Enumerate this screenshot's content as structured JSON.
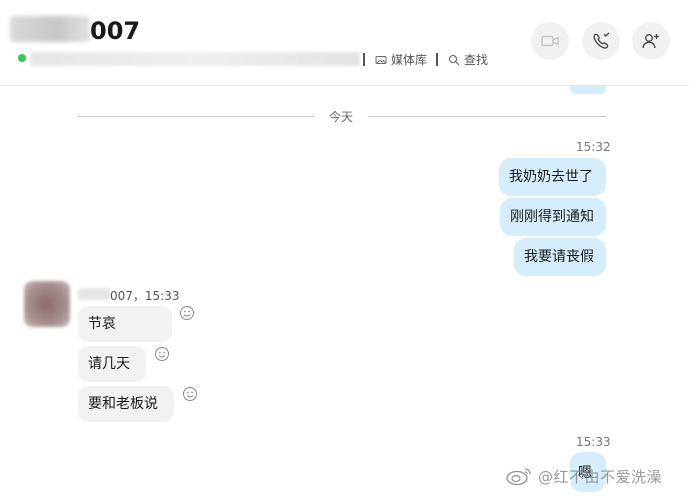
{
  "header": {
    "name_suffix": "007",
    "media_label": "媒体库",
    "search_label": "查找"
  },
  "date_separator": "今天",
  "outgoing_group_1": {
    "time": "15:32",
    "messages": [
      "我奶奶去世了",
      "刚刚得到通知",
      "我要请丧假"
    ]
  },
  "incoming_group": {
    "sender_meta": "007，15:33",
    "messages": [
      "节哀",
      "请几天",
      "要和老板说"
    ]
  },
  "outgoing_group_2": {
    "time": "15:33",
    "messages": [
      "嗯"
    ]
  },
  "watermark": "@红不由不爱洗澡",
  "colors": {
    "outgoing_bubble": "#d6eefb",
    "incoming_bubble": "#f2f2f2",
    "online": "#35c759"
  },
  "icons": [
    "video-camera-icon",
    "phone-icon",
    "add-person-icon",
    "media-library-icon",
    "search-icon",
    "emoji-reaction-icon",
    "weibo-icon"
  ]
}
